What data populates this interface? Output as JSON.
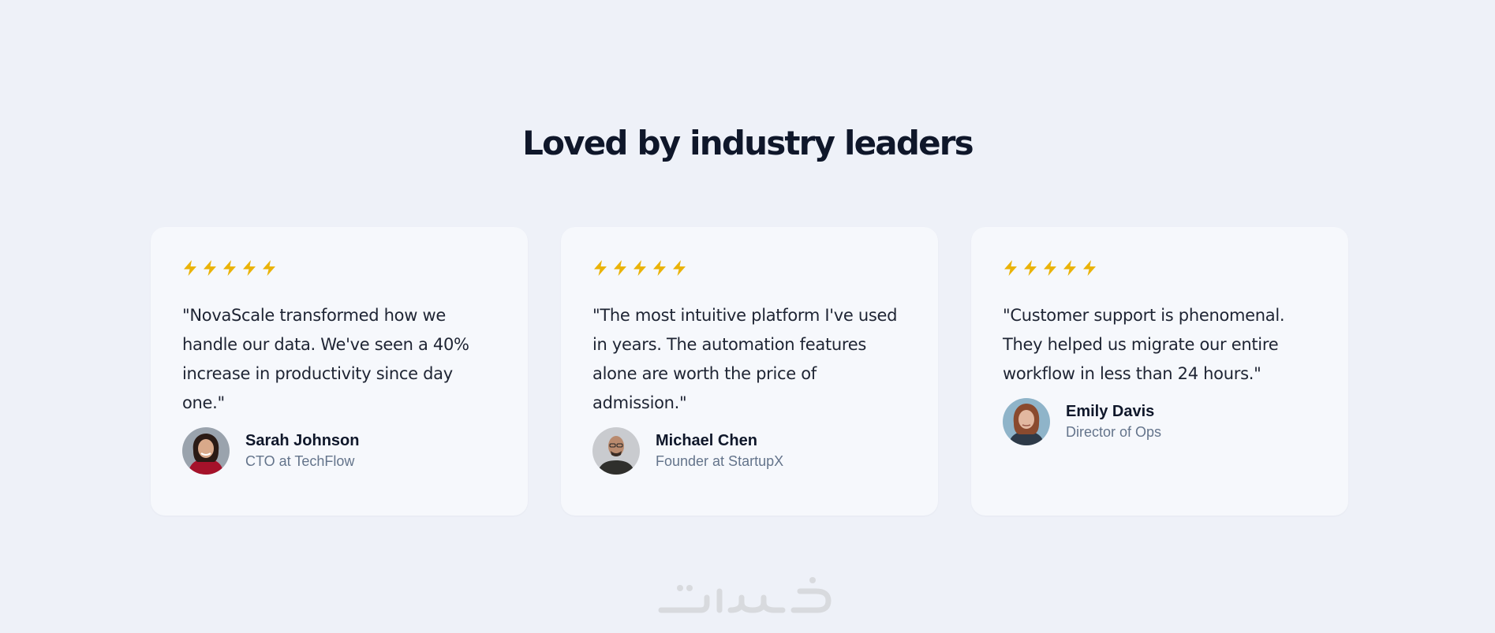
{
  "section": {
    "heading": "Loved by industry leaders"
  },
  "colors": {
    "background": "#eef1f8",
    "card": "#f6f8fc",
    "heading": "#0f172a",
    "rating_icon": "#eab308",
    "role_text": "#64748b"
  },
  "testimonials": [
    {
      "rating": 5,
      "rating_icon": "lightning-bolt-icon",
      "quote": "\"NovaScale transformed how we handle our data. We've seen a 40% increase in productivity since day one.\"",
      "name": "Sarah Johnson",
      "role": "CTO at TechFlow"
    },
    {
      "rating": 5,
      "rating_icon": "lightning-bolt-icon",
      "quote": "\"The most intuitive platform I've used in years. The automation features alone are worth the price of admission.\"",
      "name": "Michael Chen",
      "role": "Founder at StartupX"
    },
    {
      "rating": 5,
      "rating_icon": "lightning-bolt-icon",
      "quote": "\"Customer support is phenomenal. They helped us migrate our entire workflow in less than 24 hours.\"",
      "name": "Emily Davis",
      "role": "Director of Ops"
    }
  ]
}
